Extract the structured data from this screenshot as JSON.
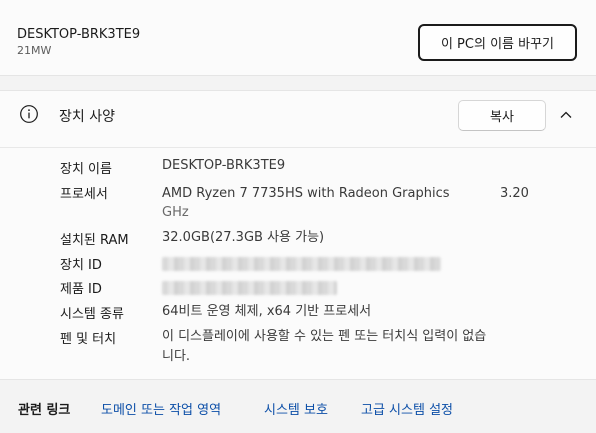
{
  "device": {
    "name": "DESKTOP-BRK3TE9",
    "model": "21MW",
    "rename_button": "이 PC의 이름 바꾸기"
  },
  "specs": {
    "title": "장치 사양",
    "copy_button": "복사",
    "rows": [
      {
        "label": "장치 이름",
        "value": "DESKTOP-BRK3TE9"
      },
      {
        "label": "프로세서",
        "value": "AMD Ryzen 7 7735HS with Radeon Graphics",
        "value_extra": "3.20",
        "value_line2": "GHz"
      },
      {
        "label": "설치된 RAM",
        "value": "32.0GB(27.3GB 사용 가능)"
      },
      {
        "label": "장치 ID",
        "value": ""
      },
      {
        "label": "제품 ID",
        "value": ""
      },
      {
        "label": "시스템 종류",
        "value": "64비트 운영 체제, x64 기반 프로세서"
      },
      {
        "label": "펜 및 터치",
        "value": "이 디스플레이에 사용할 수 있는 펜 또는 터치식 입력이 없습",
        "value_line2": "니다."
      }
    ]
  },
  "related": {
    "title": "관련 링크",
    "links": [
      "도메인 또는 작업 영역",
      "시스템 보호",
      "고급 시스템 설정"
    ]
  },
  "icons": {
    "info": "info-circle-icon",
    "collapse": "chevron-up-icon"
  }
}
